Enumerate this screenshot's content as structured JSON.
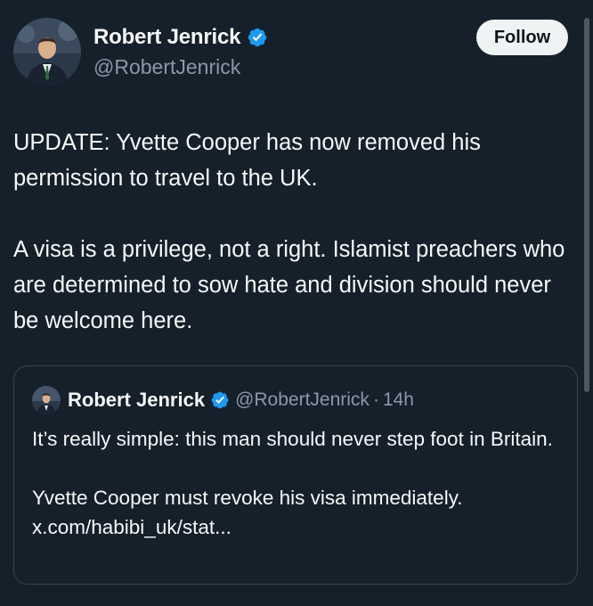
{
  "author": {
    "display_name": "Robert Jenrick",
    "handle": "@RobertJenrick",
    "verified_icon": "verified-badge-icon",
    "avatar_icon": "avatar"
  },
  "follow_button": {
    "label": "Follow"
  },
  "tweet": {
    "paragraph_1": "UPDATE: Yvette Cooper has now removed his permission to travel to the UK.",
    "paragraph_2": "A visa is a privilege, not a right. Islamist preachers who are determined to sow hate and division should never be welcome here."
  },
  "quoted_tweet": {
    "display_name": "Robert Jenrick",
    "handle": "@RobertJenrick",
    "separator": "·",
    "time": "14h",
    "paragraph_1": "It’s really simple: this man should never step foot in Britain.",
    "paragraph_2": "Yvette Cooper must revoke his visa immediately.",
    "link": "x.com/habibi_uk/stat..."
  },
  "colors": {
    "background": "#15202b",
    "text_primary": "#f7f9f9",
    "text_secondary": "#8b98a5",
    "verified_blue": "#1d9bf0",
    "follow_bg": "#eff3f4",
    "border": "#38444d"
  }
}
